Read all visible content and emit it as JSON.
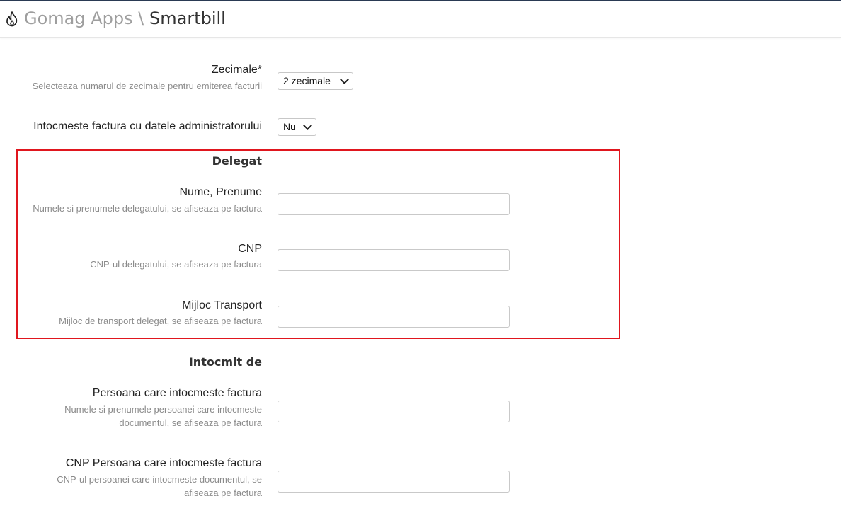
{
  "header": {
    "logo_icon": "flame-icon",
    "app_name": "Gomag Apps",
    "separator": "\\",
    "page_name": "Smartbill",
    "top_line_color": "#2b3a55"
  },
  "fields": {
    "zecimale": {
      "label": "Zecimale*",
      "hint": "Selecteaza numarul de zecimale pentru emiterea facturii",
      "selected": "2 zecimale"
    },
    "admin": {
      "label": "Intocmeste factura cu datele administratorului",
      "selected": "Nu"
    }
  },
  "delegat": {
    "title": "Delegat",
    "highlight_color": "#e0161e",
    "nume": {
      "label": "Nume, Prenume",
      "hint": "Numele si prenumele delegatului, se afiseaza pe factura",
      "value": ""
    },
    "cnp": {
      "label": "CNP",
      "hint": "CNP-ul delegatului, se afiseaza pe factura",
      "value": ""
    },
    "transport": {
      "label": "Mijloc Transport",
      "hint": "Mijloc de transport delegat, se afiseaza pe factura",
      "value": ""
    }
  },
  "intocmit": {
    "title": "Intocmit de",
    "persoana": {
      "label": "Persoana care intocmeste factura",
      "hint_line1": "Numele si prenumele persoanei care intocmeste",
      "hint_line2": "documentul, se afiseaza pe factura",
      "value": ""
    },
    "cnp": {
      "label": "CNP Persoana care intocmeste factura",
      "hint_line1": "CNP-ul persoanei care intocmeste documentul, se",
      "hint_line2": "afiseaza pe factura",
      "value": ""
    }
  }
}
